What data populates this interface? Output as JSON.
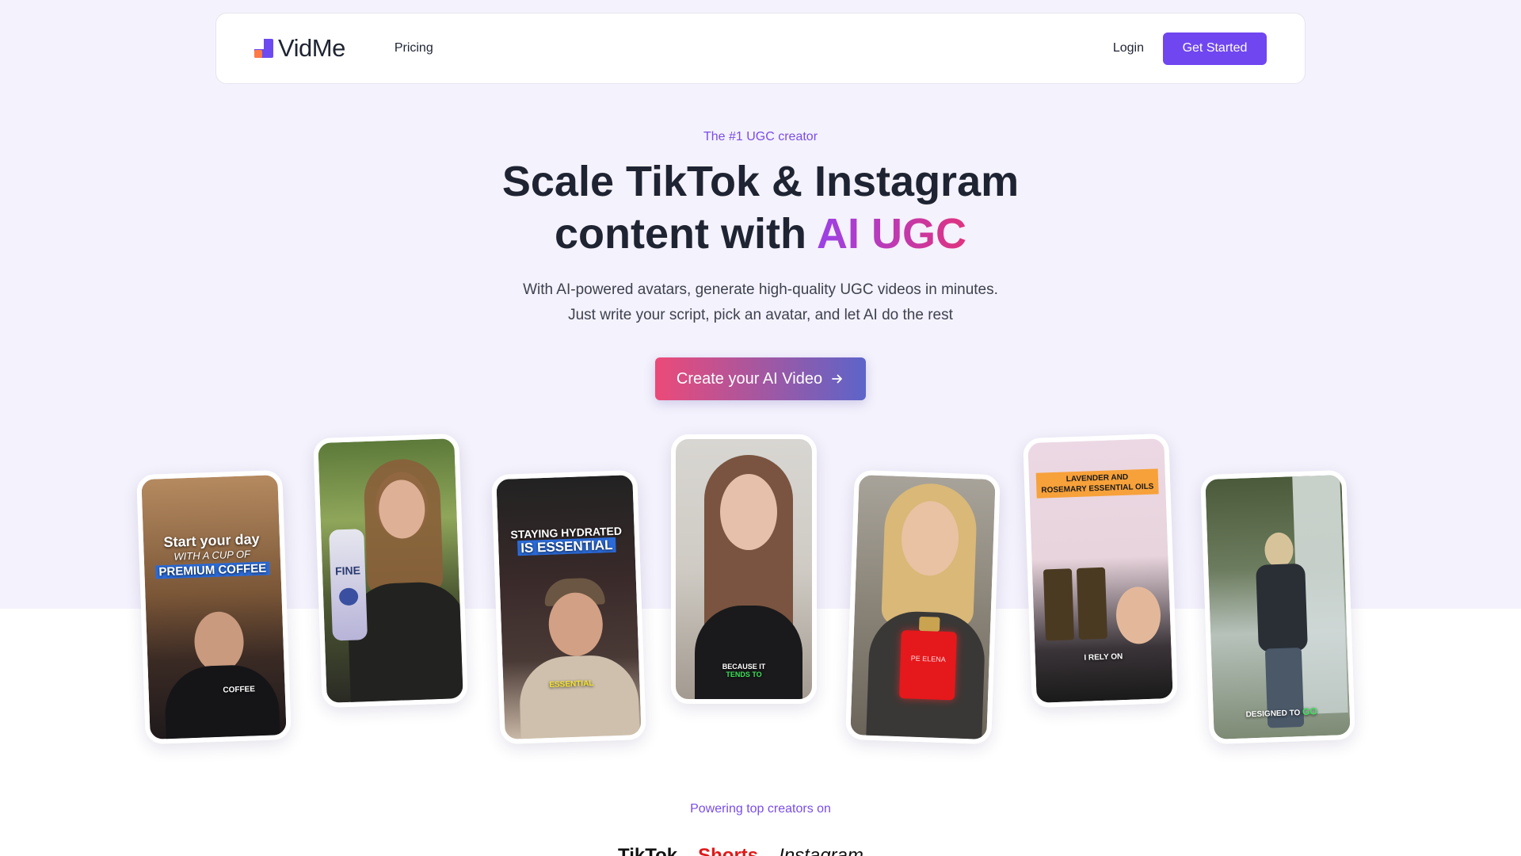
{
  "nav": {
    "logo_text": "VidMe",
    "pricing": "Pricing",
    "login": "Login",
    "get_started": "Get Started"
  },
  "hero": {
    "eyebrow": "The #1 UGC creator",
    "headline_line1": "Scale TikTok & Instagram",
    "headline_line2_plain": "content with ",
    "headline_line2_accent": "AI UGC",
    "sub_line1": "With AI-powered avatars, generate high-quality UGC videos in minutes.",
    "sub_line2": "Just write your script, pick an avatar, and let AI do the rest",
    "cta_label": "Create your AI Video",
    "cta_icon": "arrow-right-icon"
  },
  "videos": [
    {
      "caption1": "Start your day",
      "caption2": "WITH A CUP OF",
      "caption3": "PREMIUM COFFEE",
      "bottom": "COFFEE"
    },
    {
      "product": "FINE"
    },
    {
      "caption1": "STAYING HYDRATED",
      "caption2": "IS ESSENTIAL",
      "bottom": "ESSENTIAL"
    },
    {
      "bottom1": "BECAUSE IT",
      "bottom2": "TENDS TO"
    },
    {
      "product": "PE ELENA"
    },
    {
      "caption1": "LAVENDER AND",
      "caption2": "ROSEMARY ESSENTIAL OILS",
      "bottom": "I RELY ON"
    },
    {
      "bottom": "DESIGNED TO",
      "bottom_accent": "GO"
    }
  ],
  "powering": {
    "label": "Powering top creators on",
    "platforms": [
      "TikTok",
      "Shorts",
      "Instagram"
    ]
  },
  "colors": {
    "brand": "#7046f0",
    "logo_orange": "#ff7a45",
    "eyebrow": "#7a4de8",
    "accent_start": "#9b41e8",
    "accent_end": "#e0337e"
  }
}
